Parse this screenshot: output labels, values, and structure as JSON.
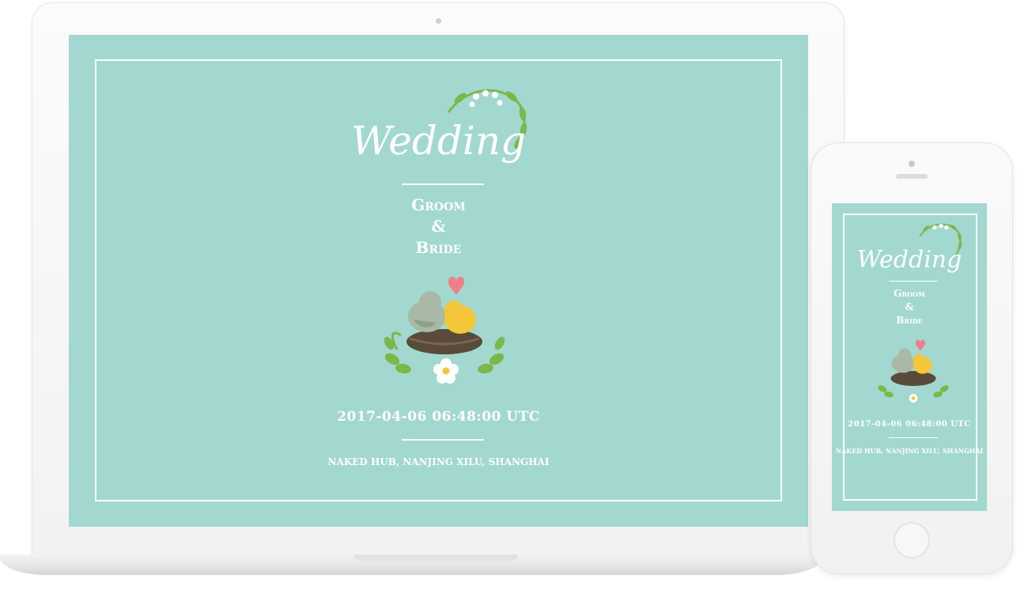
{
  "invitation": {
    "title": "Wedding",
    "groom": "Groom",
    "ampersand": "&",
    "bride": "Bride",
    "datetime": "2017-04-06 06:48:00 UTC",
    "location": "NAKED HUB, NANJING XILU, SHANGHAI"
  },
  "colors": {
    "background": "#a2d8cf",
    "text": "#ffffff",
    "leaf": "#7bb84a",
    "nest": "#5a4a3a"
  },
  "icons": [
    "laurel-branch-icon",
    "love-birds-nest-icon",
    "flower-icon"
  ]
}
